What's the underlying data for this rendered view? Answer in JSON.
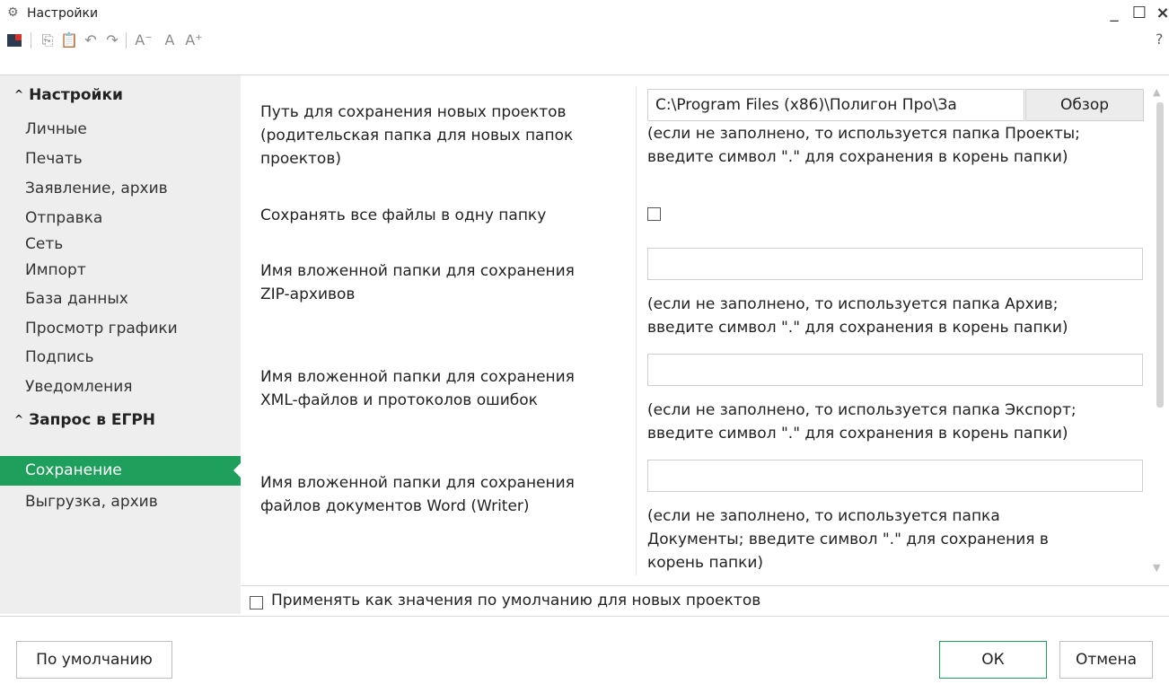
{
  "window": {
    "title": "Настройки",
    "app_icon": "gear-icon",
    "controls": {
      "minimize": "_",
      "maximize": "☐",
      "close": "×"
    }
  },
  "toolbar": {
    "icons": [
      "exit-icon",
      "copy-icon",
      "paste-icon",
      "undo-icon",
      "redo-icon",
      "font-decrease-icon",
      "font-default-icon",
      "font-increase-icon"
    ],
    "help": "?"
  },
  "sidebar": {
    "group1": "Настройки",
    "items1": [
      "Личные",
      "Печать",
      "Заявление, архив",
      "Отправка",
      "Сеть",
      "Импорт",
      "База данных",
      "Просмотр графики",
      "Подпись",
      "Уведомления"
    ],
    "group2": "Запрос в ЕГРН",
    "items2": [
      "Сохранение",
      "Выгрузка, архив"
    ],
    "active": "Сохранение",
    "active_color": "#1ea05c"
  },
  "settings": {
    "path_label_1": "Путь для сохранения новых проектов",
    "path_label_2": "(родительская папка для новых папок",
    "path_label_3": "проектов)",
    "path_value": "C:\\Program Files (x86)\\Полигон Про\\За",
    "browse": "Обзор",
    "path_hint_1": "(если не заполнено, то используется папка Проекты;",
    "path_hint_2": "введите символ \".\" для сохранения в корень папки)",
    "one_folder_label": "Сохранять все файлы в одну папку",
    "one_folder_checked": false,
    "zip_label_1": "Имя вложенной папки для сохранения",
    "zip_label_2": "ZIP-архивов",
    "zip_value": "",
    "zip_hint_1": "(если не заполнено, то используется папка Архив;",
    "zip_hint_2": "введите символ \".\" для сохранения в корень папки)",
    "xml_label_1": "Имя вложенной папки для сохранения",
    "xml_label_2": "XML-файлов и протоколов ошибок",
    "xml_value": "",
    "xml_hint_1": "(если не заполнено, то используется папка Экспорт;",
    "xml_hint_2": "введите символ \".\" для сохранения в корень папки)",
    "word_label_1": "Имя вложенной папки для сохранения",
    "word_label_2": "файлов документов Word (Writer)",
    "word_value": "",
    "word_hint_1": "(если не заполнено, то используется папка",
    "word_hint_2": "Документы; введите символ \".\" для сохранения в",
    "word_hint_3": "корень папки)"
  },
  "default_checkbox": {
    "label": "Применять как значения по умолчанию для новых проектов",
    "checked": false
  },
  "footer": {
    "default_button": "По умолчанию",
    "ok_button": "ОК",
    "cancel_button": "Отмена",
    "ok_border_color": "#1ea05c"
  }
}
